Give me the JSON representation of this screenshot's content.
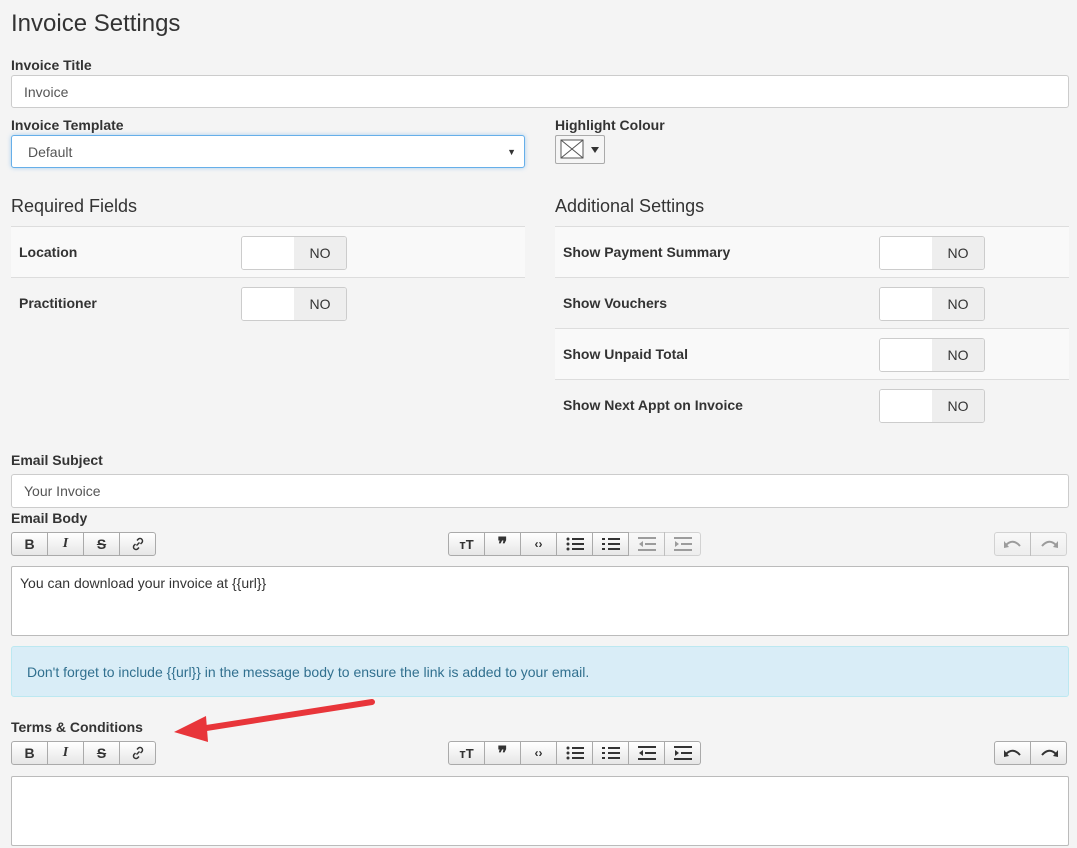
{
  "page": {
    "title": "Invoice Settings"
  },
  "invoice_title": {
    "label": "Invoice Title",
    "value": "Invoice"
  },
  "invoice_template": {
    "label": "Invoice Template",
    "value": "Default"
  },
  "highlight_colour": {
    "label": "Highlight Colour"
  },
  "required_fields": {
    "title": "Required Fields",
    "items": [
      {
        "label": "Location",
        "state": "NO"
      },
      {
        "label": "Practitioner",
        "state": "NO"
      }
    ]
  },
  "additional_settings": {
    "title": "Additional Settings",
    "items": [
      {
        "label": "Show Payment Summary",
        "state": "NO"
      },
      {
        "label": "Show Vouchers",
        "state": "NO"
      },
      {
        "label": "Show Unpaid Total",
        "state": "NO"
      },
      {
        "label": "Show Next Appt on Invoice",
        "state": "NO"
      }
    ]
  },
  "email_subject": {
    "label": "Email Subject",
    "value": "Your Invoice"
  },
  "email_body": {
    "label": "Email Body",
    "value": "You can download your invoice at {{url}}"
  },
  "alert": {
    "text": "Don't forget to include {{url}} in the message body to ensure the link is added to your email."
  },
  "terms": {
    "label": "Terms & Conditions",
    "value": ""
  },
  "toolbar": {
    "bold": "B",
    "italic": "I",
    "strike": "S",
    "icons": [
      "bold-icon",
      "italic-icon",
      "strikethrough-icon",
      "link-icon",
      "heading-icon",
      "blockquote-icon",
      "code-icon",
      "bullet-list-icon",
      "numbered-list-icon",
      "outdent-icon",
      "indent-icon",
      "undo-icon",
      "redo-icon"
    ]
  },
  "colors": {
    "accent_border": "#66afe9",
    "alert_bg": "#d9edf7",
    "alert_text": "#31708f",
    "annotation_arrow": "#e8353a"
  }
}
